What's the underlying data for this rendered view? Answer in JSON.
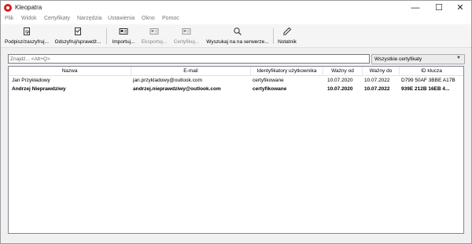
{
  "window": {
    "title": "Kleopatra",
    "minimize_glyph": "—",
    "maximize_glyph": "☐",
    "close_glyph": "✕"
  },
  "menu": [
    "Plik",
    "Widok",
    "Certyfikaty",
    "Narzędzia",
    "Ustawienia",
    "Okno",
    "Pomoc"
  ],
  "toolbar": [
    {
      "label": "Podpisz/zaszyfruj...",
      "icon": "sign-encrypt-icon",
      "enabled": true
    },
    {
      "label": "Odszyfruj/sprawdź...",
      "icon": "decrypt-verify-icon",
      "enabled": true
    },
    {
      "label": "Importuj...",
      "icon": "import-icon",
      "enabled": true
    },
    {
      "label": "Eksportuj...",
      "icon": "export-icon",
      "enabled": false
    },
    {
      "label": "Certyfikuj...",
      "icon": "certify-icon",
      "enabled": false
    },
    {
      "label": "Wyszukaj na na serwerze...",
      "icon": "search-icon",
      "enabled": true
    },
    {
      "label": "Notatnik",
      "icon": "notepad-icon",
      "enabled": true
    }
  ],
  "search": {
    "placeholder": "Znajdź... <Alt+Q>",
    "value": ""
  },
  "filter": {
    "selected": "Wszystkie certyfikaty"
  },
  "table": {
    "columns": [
      "Nazwa",
      "E-mail",
      "Identyfikatory użytkownika",
      "Ważny od",
      "Ważny do",
      "ID klucza"
    ],
    "rows": [
      {
        "name": "Jan Przykładowy",
        "email": "jan.przykladowy@outlook.com",
        "uids": "certyfikowane",
        "valid_from": "10.07.2020",
        "valid_to": "10.07.2022",
        "key_id": "D799 50AF 3BBE A17B",
        "bold": false
      },
      {
        "name": "Andrzej Nieprawdziwy",
        "email": "andrzej.nieprawdziwy@outlook.com",
        "uids": "certyfikowane",
        "valid_from": "10.07.2020",
        "valid_to": "10.07.2022",
        "key_id": "939E 212B 16EB 4...",
        "bold": true
      }
    ]
  },
  "colors": {
    "app_icon": "#d21f1f",
    "disabled_text": "#888888",
    "menu_text": "#777777"
  }
}
